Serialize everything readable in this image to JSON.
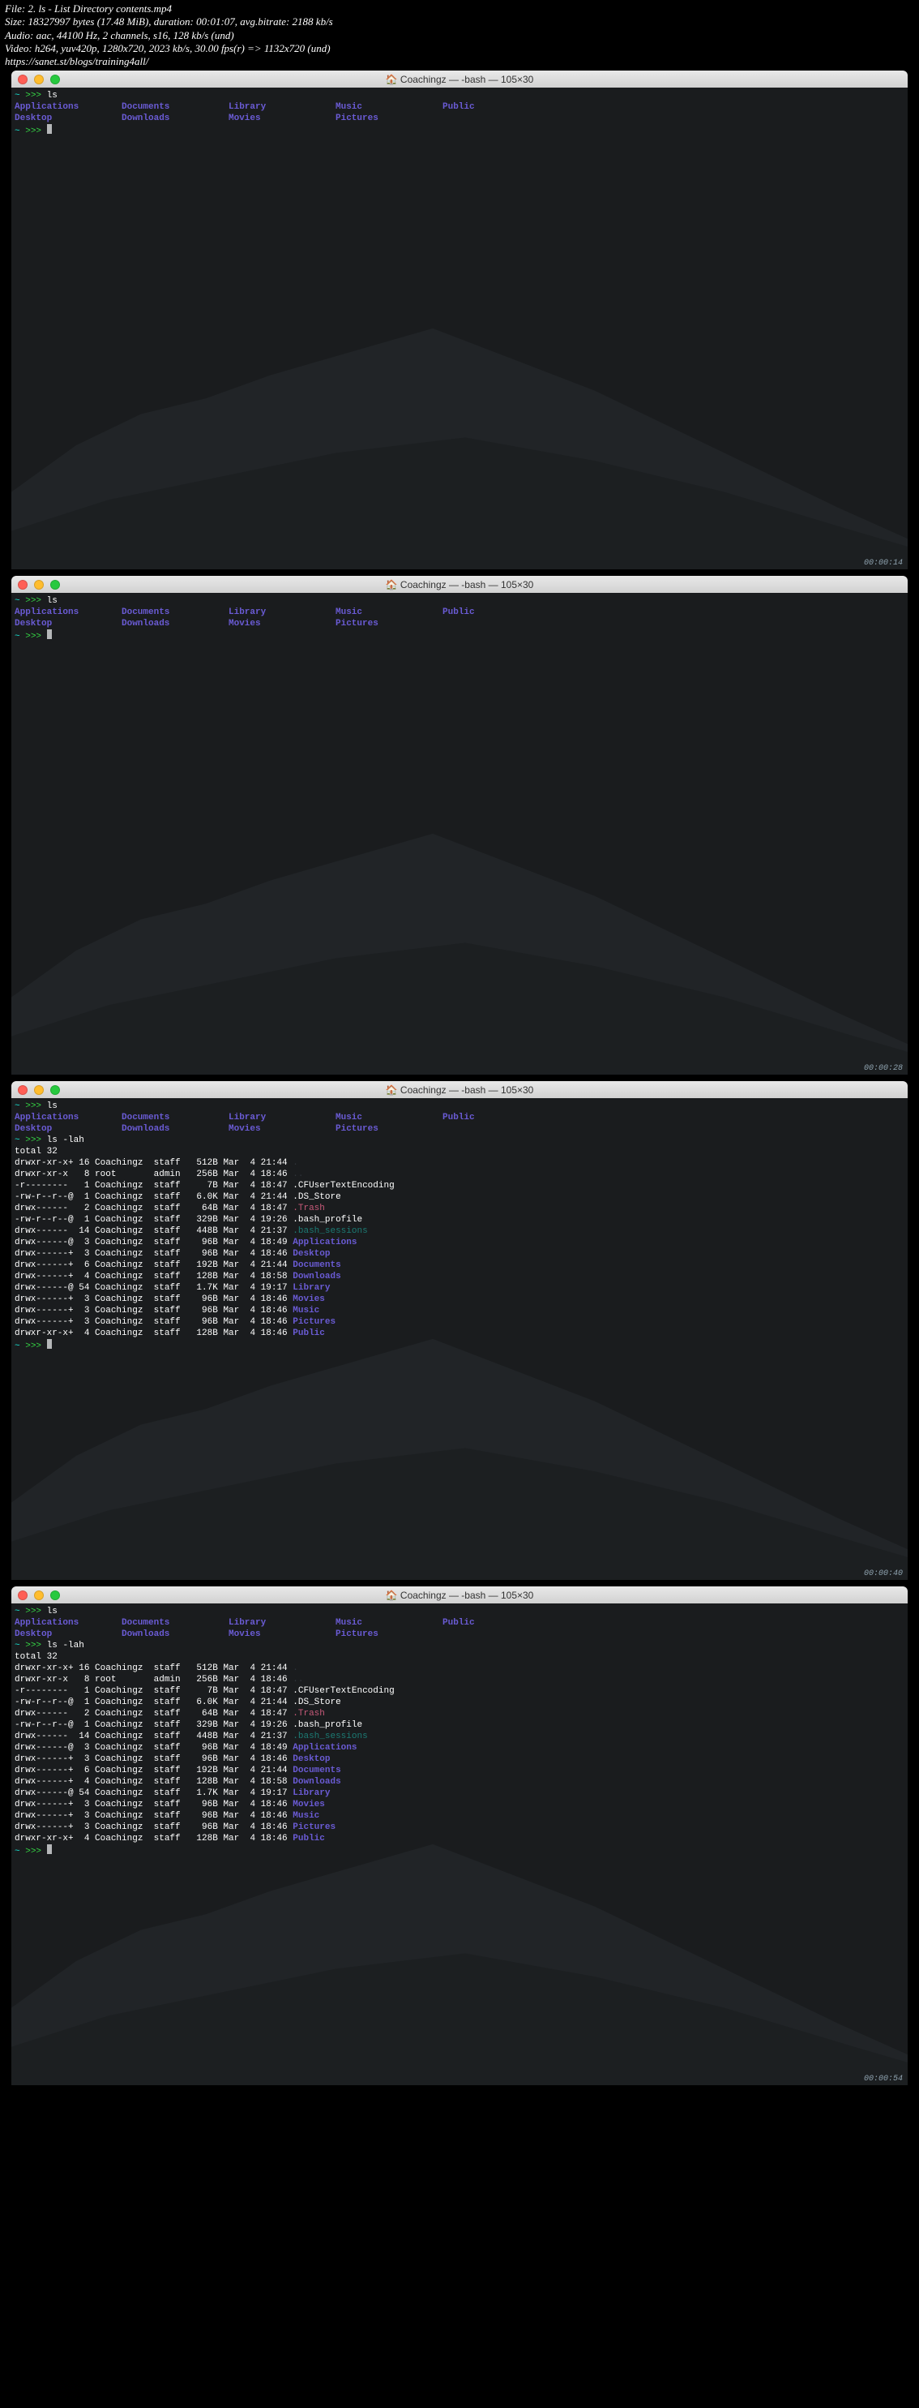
{
  "file_meta": {
    "l1": "File: 2. ls - List Directory contents.mp4",
    "l2": "Size: 18327997 bytes (17.48 MiB), duration: 00:01:07, avg.bitrate: 2188 kb/s",
    "l3": "Audio: aac, 44100 Hz, 2 channels, s16, 128 kb/s (und)",
    "l4": "Video: h264, yuv420p, 1280x720, 2023 kb/s, 30.00 fps(r) => 1132x720 (und)",
    "l5": "https://sanet.st/blogs/training4all/"
  },
  "win_title": "Coachingz — -bash — 105×30",
  "prompt_tilde": "~",
  "prompt_arrow": ">>>",
  "cmd_ls": "ls",
  "cmd_lslah": "ls -lah",
  "dirs": {
    "applications": "Applications",
    "desktop": "Desktop",
    "documents": "Documents",
    "downloads": "Downloads",
    "library": "Library",
    "movies": "Movies",
    "music": "Music",
    "pictures": "Pictures",
    "public": "Public"
  },
  "total": "total 32",
  "rows_full": [
    {
      "perm": "drwxr-xr-x+",
      "n": "16",
      "own": "Coachingz",
      "grp": "staff",
      "size": "512B",
      "date": "Mar  4 21:44",
      "name": ".",
      "cls": "dim"
    },
    {
      "perm": "drwxr-xr-x ",
      "n": " 8",
      "own": "root     ",
      "grp": "admin",
      "size": "256B",
      "date": "Mar  4 18:46",
      "name": "..",
      "cls": "dim"
    },
    {
      "perm": "-r--------",
      "n": " 1",
      "own": "Coachingz",
      "grp": "staff",
      "size": "  7B",
      "date": "Mar  4 18:47",
      "name": ".CFUserTextEncoding",
      "cls": "file"
    },
    {
      "perm": "-rw-r--r--@",
      "n": " 1",
      "own": "Coachingz",
      "grp": "staff",
      "size": "6.0K",
      "date": "Mar  4 21:44",
      "name": ".DS_Store",
      "cls": "file"
    },
    {
      "perm": "drwx------ ",
      "n": " 2",
      "own": "Coachingz",
      "grp": "staff",
      "size": " 64B",
      "date": "Mar  4 18:47",
      "name": ".Trash",
      "cls": "pink"
    },
    {
      "perm": "-rw-r--r--@",
      "n": " 1",
      "own": "Coachingz",
      "grp": "staff",
      "size": "329B",
      "date": "Mar  4 19:26",
      "name": ".bash_profile",
      "cls": "file"
    },
    {
      "perm": "drwx------ ",
      "n": "14",
      "own": "Coachingz",
      "grp": "staff",
      "size": "448B",
      "date": "Mar  4 21:37",
      "name": ".bash_sessions",
      "cls": "hidden-cyan"
    },
    {
      "perm": "drwx------@",
      "n": " 3",
      "own": "Coachingz",
      "grp": "staff",
      "size": " 96B",
      "date": "Mar  4 18:49",
      "name": "Applications",
      "cls": "dir"
    },
    {
      "perm": "drwx------+",
      "n": " 3",
      "own": "Coachingz",
      "grp": "staff",
      "size": " 96B",
      "date": "Mar  4 18:46",
      "name": "Desktop",
      "cls": "dir"
    },
    {
      "perm": "drwx------+",
      "n": " 6",
      "own": "Coachingz",
      "grp": "staff",
      "size": "192B",
      "date": "Mar  4 21:44",
      "name": "Documents",
      "cls": "dir"
    },
    {
      "perm": "drwx------+",
      "n": " 4",
      "own": "Coachingz",
      "grp": "staff",
      "size": "128B",
      "date": "Mar  4 18:58",
      "name": "Downloads",
      "cls": "dir"
    },
    {
      "perm": "drwx------@",
      "n": "54",
      "own": "Coachingz",
      "grp": "staff",
      "size": "1.7K",
      "date": "Mar  4 19:17",
      "name": "Library",
      "cls": "dir"
    },
    {
      "perm": "drwx------+",
      "n": " 3",
      "own": "Coachingz",
      "grp": "staff",
      "size": " 96B",
      "date": "Mar  4 18:46",
      "name": "Movies",
      "cls": "dir"
    },
    {
      "perm": "drwx------+",
      "n": " 3",
      "own": "Coachingz",
      "grp": "staff",
      "size": " 96B",
      "date": "Mar  4 18:46",
      "name": "Music",
      "cls": "dir"
    },
    {
      "perm": "drwx------+",
      "n": " 3",
      "own": "Coachingz",
      "grp": "staff",
      "size": " 96B",
      "date": "Mar  4 18:46",
      "name": "Pictures",
      "cls": "dir"
    },
    {
      "perm": "drwxr-xr-x+",
      "n": " 4",
      "own": "Coachingz",
      "grp": "staff",
      "size": "128B",
      "date": "Mar  4 18:46",
      "name": "Public",
      "cls": "dir"
    }
  ],
  "timestamps": {
    "t1": "00:00:14",
    "t2": "00:00:28",
    "t3": "00:00:40",
    "t4": "00:00:54"
  }
}
